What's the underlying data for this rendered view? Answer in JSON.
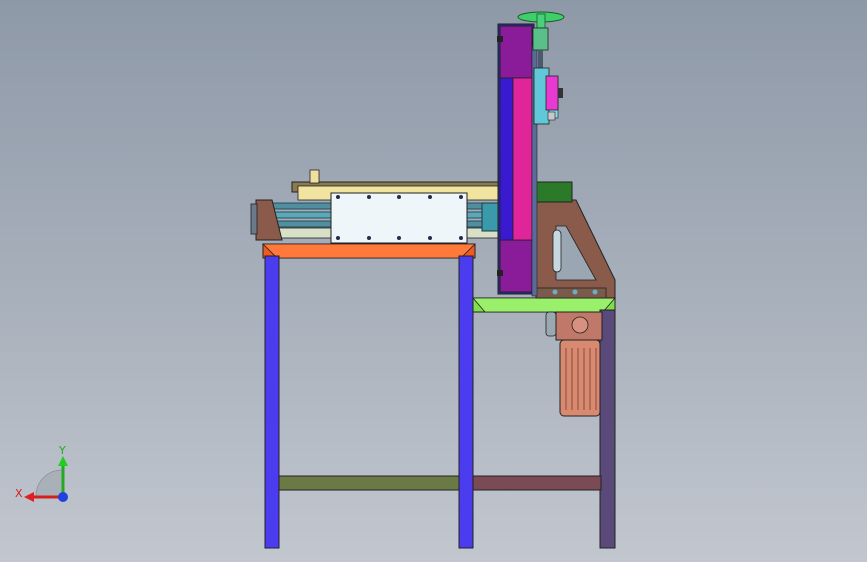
{
  "triad": {
    "x_label": "X",
    "y_label": "Y"
  },
  "colors": {
    "background_top": "#8e99a8",
    "background_bottom": "#c2c7cf",
    "leg_blue": "#4b3cf0",
    "top_frame_orange": "#f05a1e",
    "stretcher_olive": "#6b7a45",
    "stretcher_maroon": "#7a4a55",
    "shelf_green": "#7ee04a",
    "belt_magenta": "#e0249a",
    "guard_purple": "#8a1c9a",
    "bracket_brown": "#8a5a4a",
    "motor_copper": "#d88a70",
    "handwheel_green": "#3ecf6a",
    "slide_cyan": "#60c8d8",
    "cover_plate": "#eef6fa"
  }
}
